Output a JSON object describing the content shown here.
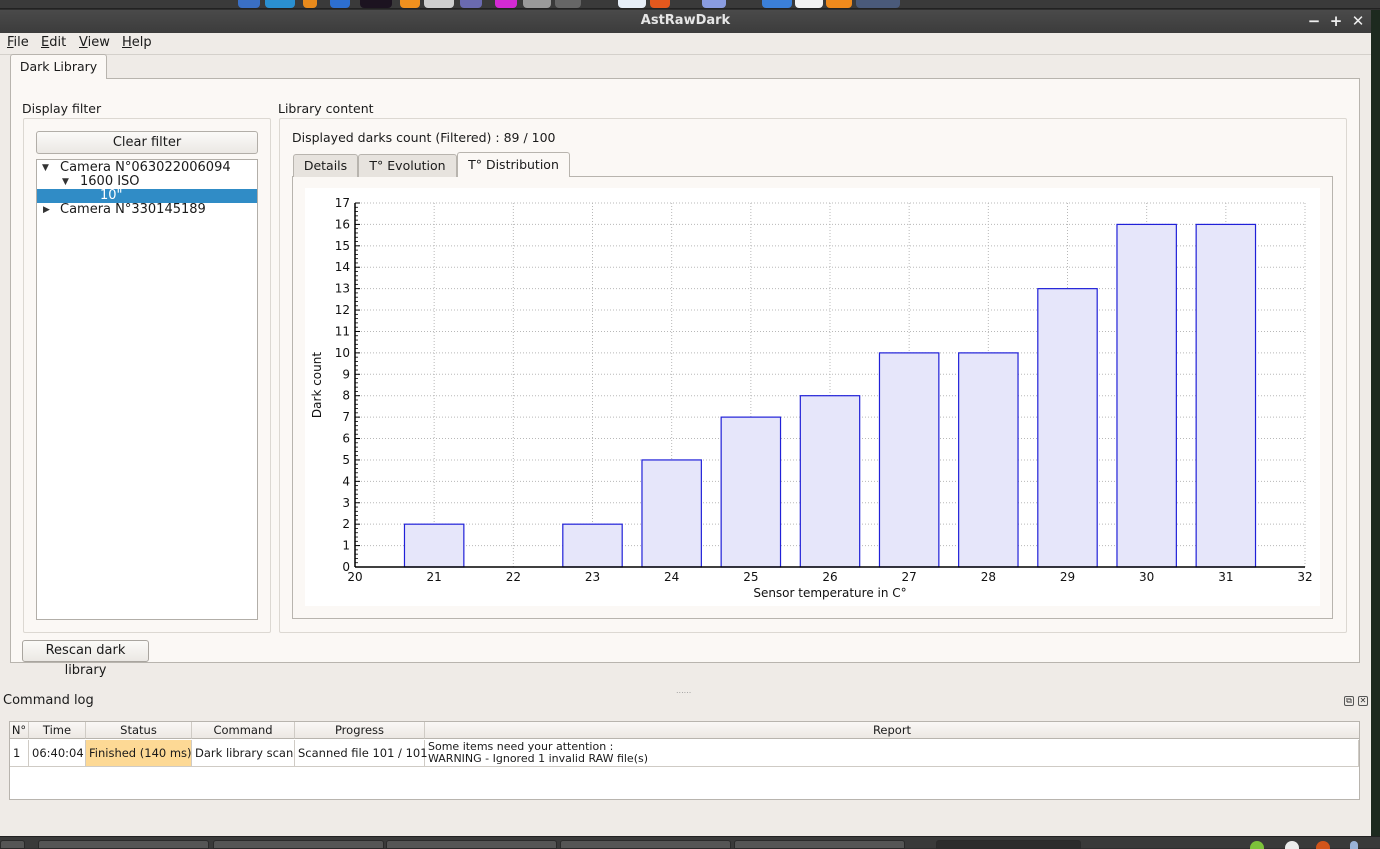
{
  "window": {
    "title": "AstRawDark",
    "controls": {
      "minimize": "−",
      "maximize": "+",
      "close": "✕"
    }
  },
  "menu": [
    {
      "label": "File",
      "mnemonic": "F",
      "rest": "ile"
    },
    {
      "label": "Edit",
      "mnemonic": "E",
      "rest": "dit"
    },
    {
      "label": "View",
      "mnemonic": "V",
      "rest": "iew"
    },
    {
      "label": "Help",
      "mnemonic": "H",
      "rest": "elp"
    }
  ],
  "main_tab": {
    "label": "Dark Library"
  },
  "display_filter": {
    "title": "Display filter",
    "clear_button": "Clear filter",
    "tree": [
      {
        "label": "Camera N°063022006094",
        "level": 0,
        "expanded": true,
        "selected": false
      },
      {
        "label": "1600 ISO",
        "level": 1,
        "expanded": true,
        "selected": false
      },
      {
        "label": "10\"",
        "level": 2,
        "expanded": null,
        "selected": true
      },
      {
        "label": "Camera N°330145189",
        "level": 0,
        "expanded": false,
        "selected": false
      }
    ]
  },
  "library_content": {
    "title": "Library content",
    "count_label": "Displayed darks count (Filtered) : 89 / 100",
    "tabs": [
      {
        "label": "Details",
        "active": false
      },
      {
        "label": "T° Evolution",
        "active": false
      },
      {
        "label": "T° Distribution",
        "active": true
      }
    ]
  },
  "chart_data": {
    "type": "bar",
    "title": "",
    "xlabel": "Sensor temperature in C°",
    "ylabel": "Dark count",
    "x": [
      21,
      22,
      23,
      24,
      25,
      26,
      27,
      28,
      29,
      30,
      31
    ],
    "values": [
      2,
      0,
      2,
      5,
      7,
      8,
      10,
      10,
      13,
      16,
      16
    ],
    "xlim": [
      20,
      32
    ],
    "ylim": [
      0,
      17
    ],
    "xticks": [
      20,
      21,
      22,
      23,
      24,
      25,
      26,
      27,
      28,
      29,
      30,
      31,
      32
    ],
    "yticks": [
      0,
      1,
      2,
      3,
      4,
      5,
      6,
      7,
      8,
      9,
      10,
      11,
      12,
      13,
      14,
      15,
      16,
      17
    ],
    "bar_width_units": 0.75,
    "grid": true,
    "bar_fill": "#e6e6fa",
    "bar_stroke": "#2020d8"
  },
  "rescan_button": "Rescan dark library",
  "command_log": {
    "title": "Command log",
    "columns": [
      "N°",
      "Time",
      "Status",
      "Command",
      "Progress",
      "Report"
    ],
    "rows": [
      {
        "n": "1",
        "time": "06:40:04",
        "status": "Finished (140 ms)",
        "status_color": "#fdd995",
        "command": "Dark library scan",
        "progress": "Scanned file 101 / 101",
        "report_line1": "Some items need your attention :",
        "report_line2": "WARNING - Ignored 1 invalid RAW file(s)"
      }
    ]
  }
}
